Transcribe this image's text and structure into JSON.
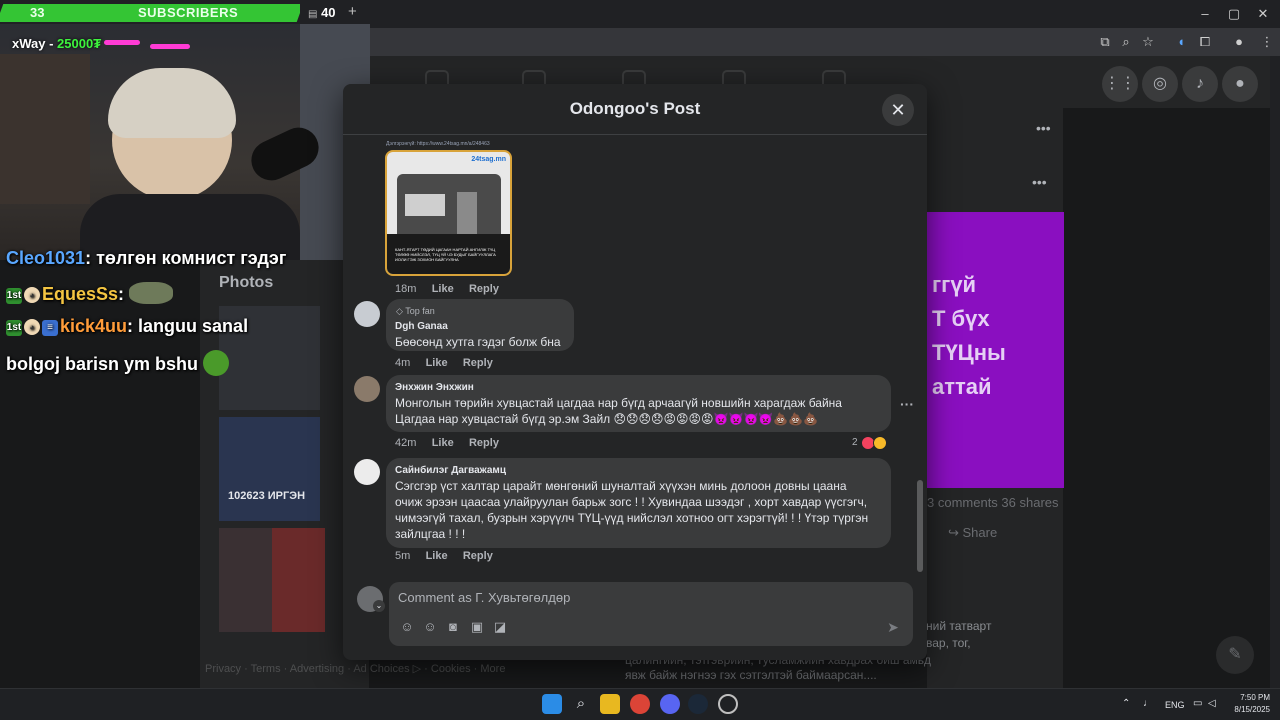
{
  "overlay": {
    "subs_count": "33",
    "subs_label": "SUBSCRIBERS",
    "subs_goal": "40",
    "goal_plus": "+",
    "donor_name": "xWay",
    "donor_amount": "25000₮",
    "chat": [
      {
        "user": "Cleo1031",
        "message": "төлгөн комнист гэдэг",
        "user_color": "#5aa7ff"
      },
      {
        "user": "EquesSs",
        "message": "",
        "user_color": "#f4c542"
      },
      {
        "user": "kick4uu",
        "message": "languu sanal",
        "user_color": "#ff9c3a"
      },
      {
        "user": "",
        "message": "bolgoj barisn ym bshu",
        "user_color": "#ffffff"
      }
    ]
  },
  "browser": {
    "window_buttons": [
      "–",
      "▢",
      "✕"
    ]
  },
  "background": {
    "photos_title": "Photos",
    "purple_lines": [
      "ггүй",
      "Т бүх",
      "ТҮЦны",
      "аттай"
    ],
    "stats_text": "3 comments   36 shares",
    "share_label": "Share",
    "para_lines": [
      "ний татварт",
      "вар, тог,"
    ],
    "below_lines": [
      "цалингийн, тэтгэврийн, тусламжийн хавдрах биш амьд",
      "явж байж нэгнээ гэх сэтгэлтэй баймаарсан...."
    ],
    "footer": "Privacy · Terms · Advertising · Ad Choices ▷ · Cookies · More"
  },
  "modal": {
    "title": "Odongoo's Post",
    "image_caption": "Дэлгэрэнгүй: https://www.24tsag.mn/a/248463",
    "image_logo": "24tsag.mn",
    "image_text": "КАНТ-ЯТАРТ ТӨДИЙ ЦАГААН НАРТАЙ АНГИЛЖ ТҮЦ ТӨЛӨӨ НИЙСЛЭЛ, ТҮЦ ҮЙ ЧЭ БУДЫГ БАЙГУУЛЛАГА ИОЛИ ГЭЖ ЗОХИОН БАЙГУУЛНА",
    "post_meta": {
      "time": "18m",
      "like": "Like",
      "reply": "Reply"
    },
    "comments": [
      {
        "badge": "Top fan",
        "name": "Dgh Ganaa",
        "text": "Бөөсөнд хутга гэдэг болж бна",
        "time": "4m",
        "like": "Like",
        "reply": "Reply"
      },
      {
        "name": "Энхжин Энхжин",
        "text_lines": [
          "Монголын төрийн хувцастай цагдаа нар бүгд арчаагүй новшийн харагдаж байна",
          "Цагдаа нар хувцастай бүгд эр.эм Зайл 😞😞😞😞😡😡😡😡👿👿👿👿💩💩💩"
        ],
        "time": "42m",
        "like": "Like",
        "reply": "Reply",
        "reactions": "2"
      },
      {
        "name": "Сайнбилэг Дагважамц",
        "text_lines": [
          "Сэгсгэр үст халтар царайт мөнгөний шуналтай хүүхэн минь долоон довны цаана",
          "очиж эрээн цаасаа улайруулан барьж зогс ! ! Хувиндаа шээдэг , хорт хавдар үүсгэгч,",
          "чимээгүй тахал, бузрын хэрүүлч ТҮЦ-үүд нийслэл хотноо огт хэрэгтүй! ! ! Үтэр түргэн",
          "зайлцгаа ! ! !"
        ],
        "time": "5m",
        "like": "Like",
        "reply": "Reply"
      }
    ],
    "composer_placeholder": "Comment as Г. Хувьтөгөлдөр"
  },
  "taskbar": {
    "lang": "ENG",
    "time": "7:50 PM",
    "date": "8/15/2025"
  },
  "colors": {
    "fb_bg": "#18191a",
    "modal_bg": "#242526",
    "bubble": "#3a3b3c",
    "sub_green": "#34c534",
    "purple_post": "#8a0fc0"
  }
}
